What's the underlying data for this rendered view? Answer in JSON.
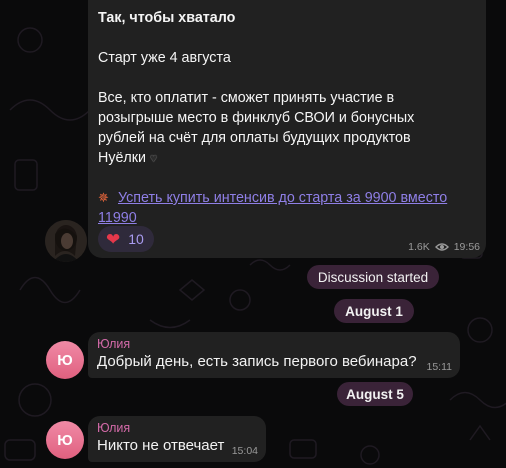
{
  "channel_post": {
    "title": "Так, чтобы хватало",
    "start": "Старт уже 4 августа",
    "body_lines": [
      "Все, кто оплатит - сможет принять участие в",
      "розыгрыше место в финклуб СВОИ и бонусных",
      "рублей на счёт для оплаты будущих продуктов",
      "Нуёлки"
    ],
    "link_lines": [
      "Успеть купить интенсив до старта за 9900 вместо",
      "11990"
    ],
    "reaction_count": "10",
    "views": "1.6K",
    "time": "19:56",
    "icons": {
      "reaction": "red-heart",
      "inline_end": "black-heart",
      "link_prefix": "collision-emoji",
      "views": "eye-icon"
    }
  },
  "service": {
    "discussion_started": "Discussion started",
    "date_1": "August 1",
    "date_2": "August 5"
  },
  "messages": [
    {
      "sender": "Юлия",
      "avatar_letter": "Ю",
      "text": "Добрый день, есть запись первого вебинара?",
      "time": "15:11"
    },
    {
      "sender": "Юлия",
      "avatar_letter": "Ю",
      "text": "Никто не отвечает",
      "time": "15:04"
    }
  ],
  "colors": {
    "bubble": "#212121",
    "accent_link": "#8f7fe6",
    "sender": "#d36aa8",
    "pill": "#3a2338",
    "avatar": "#e0607f"
  }
}
